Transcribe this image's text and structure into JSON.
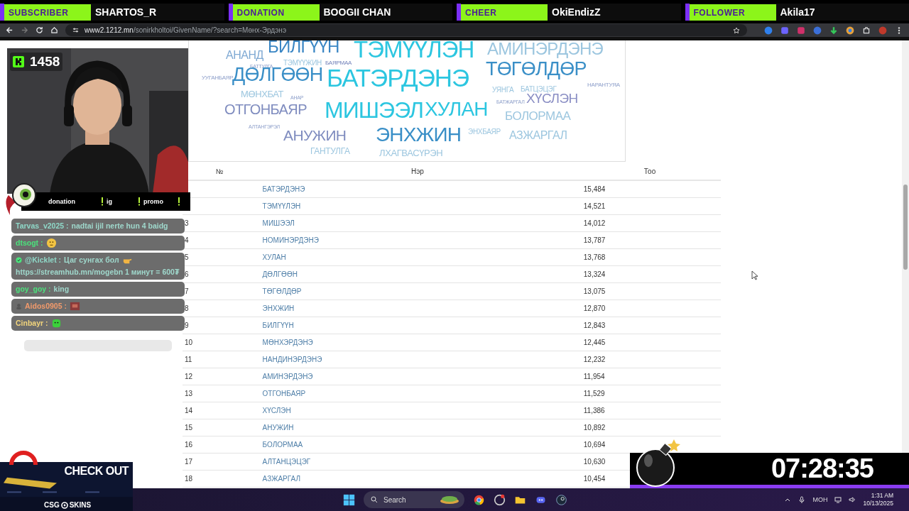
{
  "alerts": [
    {
      "label": "SUBSCRIBER",
      "name": "SHARTOS_R"
    },
    {
      "label": "DONATION",
      "name": "BOOGII CHAN"
    },
    {
      "label": "CHEER",
      "name": "OkiEndizZ"
    },
    {
      "label": "FOLLOWER",
      "name": "Akila17"
    }
  ],
  "browser": {
    "host": "www2.1212.mn",
    "path": "/sonirkholtoi/GivenName/?search=Мөнх-Эрдэнэ"
  },
  "word_cloud": [
    {
      "text": "АНАНД",
      "color": "#7fa9d3"
    },
    {
      "text": "БИЛГҮҮН",
      "color": "#3a86c4"
    },
    {
      "text": "ТЭМҮҮЛЭН",
      "color": "#2cc6e0"
    },
    {
      "text": "АМИНЭРДЭНЭ",
      "color": "#9cc6df"
    },
    {
      "text": "ТЭМҮҮЖИН",
      "color": "#9cc6df"
    },
    {
      "text": "БАЯРМАА",
      "color": "#6f7fb8"
    },
    {
      "text": "БАТТУЛГА"
    },
    {
      "text": "УУГАНБАЯР"
    },
    {
      "text": "ДӨЛГӨӨН",
      "color": "#3a8fc7"
    },
    {
      "text": "БАТЭРДЭНЭ",
      "color": "#2cc6e0"
    },
    {
      "text": "ТӨГӨЛДӨР",
      "color": "#3a8fc7"
    },
    {
      "text": "УЯНГА",
      "color": "#9cc6df"
    },
    {
      "text": "БАТЦЭЦЭГ",
      "color": "#9cc6df"
    },
    {
      "text": "НАРАНТУЯА"
    },
    {
      "text": "МӨНХБАТ",
      "color": "#9cc6df"
    },
    {
      "text": "АНАР"
    },
    {
      "text": "БАТЖАРГАЛ"
    },
    {
      "text": "ХҮСЛЭН",
      "color": "#8a8ec4"
    },
    {
      "text": "ОТГОНБАЯР",
      "color": "#7f8cbf"
    },
    {
      "text": "МИШЭЭЛ",
      "color": "#2cc6e0"
    },
    {
      "text": "ХУЛАН",
      "color": "#2cc6e0"
    },
    {
      "text": "БОЛОРМАА",
      "color": "#9cc6df"
    },
    {
      "text": "АЛТАНГЭРЭЛ"
    },
    {
      "text": "АНУЖИН",
      "color": "#7f8cbf"
    },
    {
      "text": "ЭНХЖИН",
      "color": "#3a8fc7"
    },
    {
      "text": "ЭНХБАЯР",
      "color": "#9cc6df"
    },
    {
      "text": "АЗЖАРГАЛ",
      "color": "#9cc6df"
    },
    {
      "text": "ГАНТУЛГА",
      "color": "#9cc6df"
    },
    {
      "text": "ЛХАГВАСҮРЭН",
      "color": "#9cc6df"
    }
  ],
  "table": {
    "columns": [
      "№",
      "Нэр",
      "Тоо"
    ],
    "rows": [
      {
        "name": "БАТЭРДЭНЭ",
        "count": "15,484"
      },
      {
        "name": "ТЭМҮҮЛЭН",
        "count": "14,521"
      },
      {
        "number": "3",
        "name": "МИШЭЭЛ",
        "count": "14,012"
      },
      {
        "number": "4",
        "name": "НОМИНЭРДЭНЭ",
        "count": "13,787"
      },
      {
        "number": "5",
        "name": "ХУЛАН",
        "count": "13,768"
      },
      {
        "number": "6",
        "name": "ДӨЛГӨӨН",
        "count": "13,324"
      },
      {
        "number": "7",
        "name": "ТӨГӨЛДӨР",
        "count": "13,075"
      },
      {
        "number": "8",
        "name": "ЭНХЖИН",
        "count": "12,870"
      },
      {
        "number": "9",
        "name": "БИЛГҮҮН",
        "count": "12,843"
      },
      {
        "number": "10",
        "name": "МӨНХЭРДЭНЭ",
        "count": "12,445"
      },
      {
        "number": "11",
        "name": "НАНДИНЭРДЭНЭ",
        "count": "12,232"
      },
      {
        "number": "12",
        "name": "АМИНЭРДЭНЭ",
        "count": "11,954"
      },
      {
        "number": "13",
        "name": "ОТГОНБАЯР",
        "count": "11,529"
      },
      {
        "number": "14",
        "name": "ХҮСЛЭН",
        "count": "11,386"
      },
      {
        "number": "15",
        "name": "АНУЖИН",
        "count": "10,892"
      },
      {
        "number": "16",
        "name": "БОЛОРМАА",
        "count": "10,694"
      },
      {
        "number": "17",
        "name": "АЛТАНЦЭЦЭГ",
        "count": "10,630"
      },
      {
        "number": "18",
        "name": "АЗЖАРГАЛ",
        "count": "10,454"
      }
    ]
  },
  "stream": {
    "viewers": "1458",
    "commands": [
      "donation",
      "ig",
      "promo"
    ],
    "chat": [
      {
        "kind": "text",
        "user": "Tarvas_v2025 :",
        "color": "#8fd8c8",
        "text": "nadtai ijil nerte hun 4 baidg"
      },
      {
        "kind": "thinking",
        "user": "dtsogt :",
        "color": "#4be27c"
      },
      {
        "kind": "promo",
        "user": "@Kicklet :",
        "color": "#8fd8c8",
        "text": "Цаг сунгах бол",
        "text2": "https://streamhub.mn/mogebn 1 минут = 600₮"
      },
      {
        "kind": "text",
        "user": "goy_goy :",
        "color": "#4be27c",
        "text": "king"
      },
      {
        "kind": "sticker",
        "user": "Aidos0905 :",
        "color": "#f29a6b"
      },
      {
        "kind": "slime",
        "user": "Cinbayr :",
        "color": "#f2d57c"
      }
    ],
    "ad": {
      "headline": "CHECK OUT",
      "brand_left": "CSG",
      "brand_right": "SKINS"
    },
    "timer": "07:28:35"
  },
  "taskbar": {
    "search_placeholder": "Search",
    "language": "МОН",
    "time": "1:31 AM",
    "date": "10/13/2025"
  }
}
